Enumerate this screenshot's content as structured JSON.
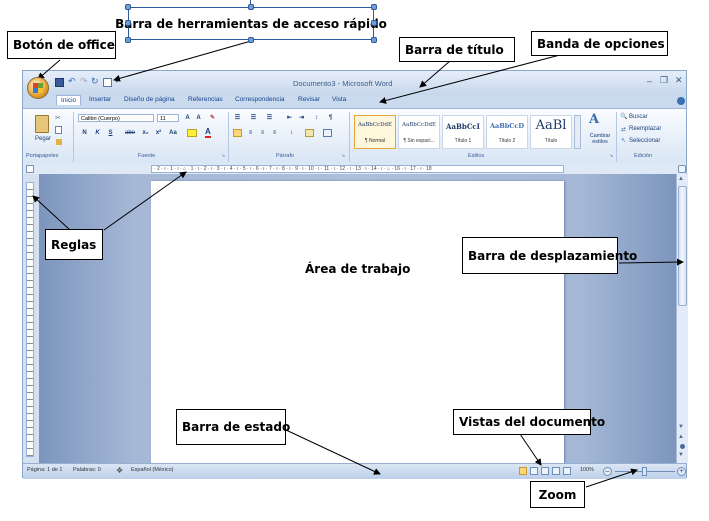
{
  "callouts": {
    "quick_access": "Barra de herramientas de acceso rápido",
    "office_button": "Botón de office",
    "title_bar": "Barra de título",
    "ribbon": "Banda de opciones",
    "rulers": "Reglas",
    "scroll_bar": "Barra de desplazamiento",
    "work_area": "Área de trabajo",
    "status_bar": "Barra de estado",
    "doc_views": "Vistas del documento",
    "zoom": "Zoom"
  },
  "window": {
    "title": "Documento3 - Microsoft Word",
    "controls": {
      "minimize": "–",
      "restore": "❐",
      "close": "✕"
    }
  },
  "tabs": [
    "Inicio",
    "Insertar",
    "Diseño de página",
    "Referencias",
    "Correspondencia",
    "Revisar",
    "Vista"
  ],
  "ribbon": {
    "groups": {
      "clipboard": "Portapapeles",
      "font": "Fuente",
      "paragraph": "Párrafo",
      "styles": "Estilos",
      "editing": "Edición"
    },
    "paste_label": "Pegar",
    "font_name": "Calibri (Cuerpo)",
    "font_size": "11",
    "format_buttons": [
      "N",
      "K",
      "S",
      "abe",
      "x₂",
      "x²",
      "Aa"
    ],
    "styles": [
      {
        "sample": "AaBbCcDdE",
        "name": "¶ Normal"
      },
      {
        "sample": "AaBbCcDdE",
        "name": "¶ Sin espaci..."
      },
      {
        "sample": "AaBbCcI",
        "name": "Título 1"
      },
      {
        "sample": "AaBbCcD",
        "name": "Título 2"
      },
      {
        "sample": "AaBl",
        "name": "Título"
      }
    ],
    "change_styles": "Cambiar estilos",
    "editing_items": [
      "Buscar",
      "Reemplazar",
      "Seleccionar"
    ]
  },
  "ruler_numbers": "· 2 · ı · 1 · ı · ⌂ · 1 · ı · 2 · ı · 3 · ı · 4 · ı · 5 · ı · 6 · ı · 7 · ı · 8 · ı · 9 · ı · 10 · ı · 11 · ı · 12 · ı · 13 · ı · 14 · ı · ⌂ · 16 · ı · 17 · ı · 18",
  "status": {
    "page": "Página: 1 de 1",
    "words": "Palabras: 0",
    "language": "Español (México)",
    "zoom": "100%"
  },
  "colors": {
    "accent": "#15428b",
    "ribbon_bg": "#d8e5f4",
    "document_bg": "#a5b8d6"
  }
}
